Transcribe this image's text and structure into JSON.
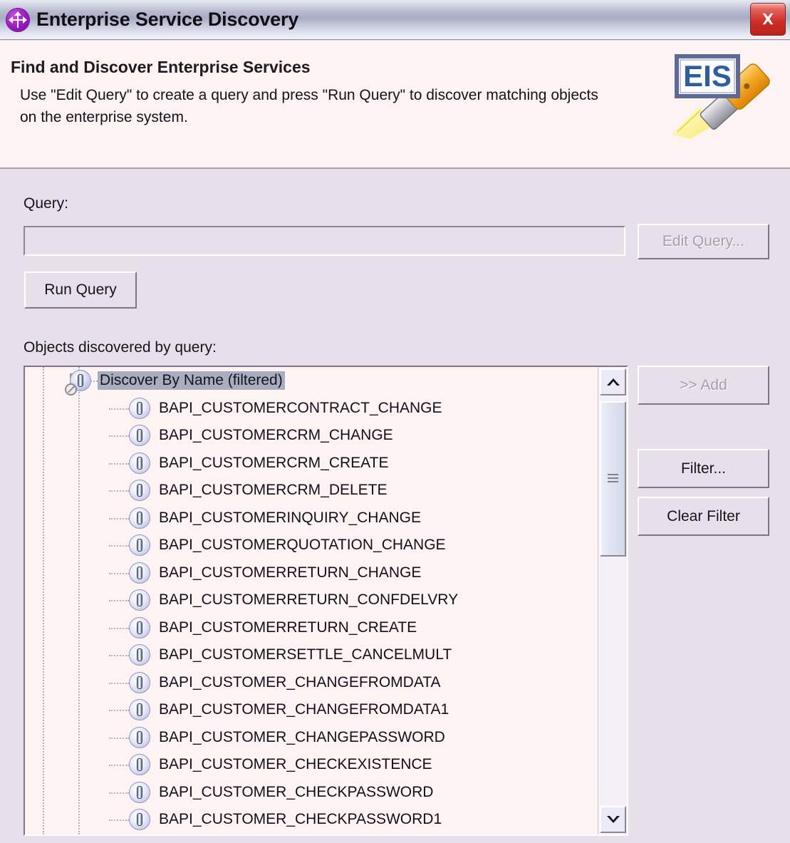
{
  "window": {
    "title": "Enterprise Service Discovery",
    "title_icon": "discovery-node-icon",
    "close_label": "✕"
  },
  "header": {
    "title": "Find and Discover Enterprise Services",
    "description": "Use \"Edit Query\" to create a query and press \"Run Query\" to discover matching objects on the enterprise system.",
    "logo_text": "EIS",
    "logo_icon": "eis-paintbrush-logo"
  },
  "query": {
    "label": "Query:",
    "value": "",
    "placeholder": "",
    "edit_button": "Edit Query...",
    "run_button": "Run Query"
  },
  "results": {
    "label": "Objects discovered by query:",
    "root": {
      "label": "Discover By Name (filtered)",
      "expanded_glyph": "minus",
      "selected": true,
      "icon": "service-object-filtered-icon"
    },
    "items": [
      "BAPI_CUSTOMERCONTRACT_CHANGE",
      "BAPI_CUSTOMERCRM_CHANGE",
      "BAPI_CUSTOMERCRM_CREATE",
      "BAPI_CUSTOMERCRM_DELETE",
      "BAPI_CUSTOMERINQUIRY_CHANGE",
      "BAPI_CUSTOMERQUOTATION_CHANGE",
      "BAPI_CUSTOMERRETURN_CHANGE",
      "BAPI_CUSTOMERRETURN_CONFDELVRY",
      "BAPI_CUSTOMERRETURN_CREATE",
      "BAPI_CUSTOMERSETTLE_CANCELMULT",
      "BAPI_CUSTOMER_CHANGEFROMDATA",
      "BAPI_CUSTOMER_CHANGEFROMDATA1",
      "BAPI_CUSTOMER_CHANGEPASSWORD",
      "BAPI_CUSTOMER_CHECKEXISTENCE",
      "BAPI_CUSTOMER_CHECKPASSWORD",
      "BAPI_CUSTOMER_CHECKPASSWORD1"
    ]
  },
  "actions": {
    "add": ">> Add",
    "filter": "Filter...",
    "clear_filter": "Clear Filter"
  },
  "scrollbar": {
    "up_icon": "chevron-up-icon",
    "down_icon": "chevron-down-icon"
  },
  "colors": {
    "dialog_bg": "#e7dfe9",
    "header_bg": "#fdf3f3",
    "list_bg": "#fdf3f3",
    "selection": "#a8adc0",
    "close_red": "#cc2e26",
    "title_icon_purple": "#9a18c0"
  }
}
